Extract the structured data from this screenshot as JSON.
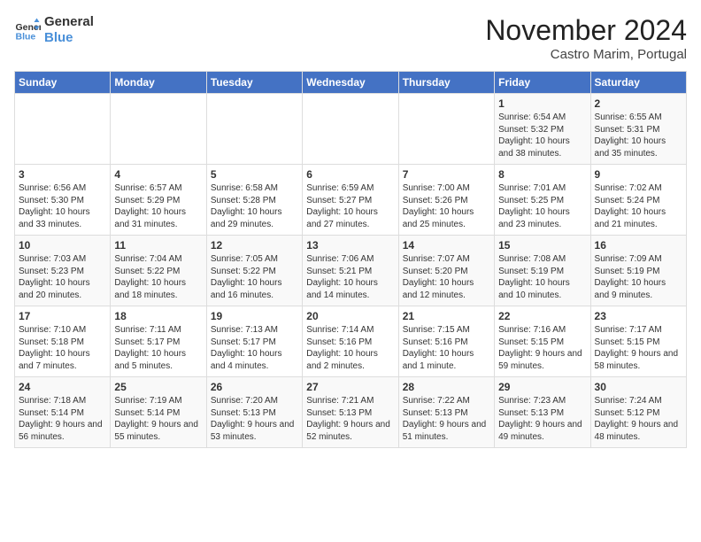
{
  "logo": {
    "line1": "General",
    "line2": "Blue"
  },
  "header": {
    "month": "November 2024",
    "location": "Castro Marim, Portugal"
  },
  "days_of_week": [
    "Sunday",
    "Monday",
    "Tuesday",
    "Wednesday",
    "Thursday",
    "Friday",
    "Saturday"
  ],
  "weeks": [
    [
      {
        "day": "",
        "content": ""
      },
      {
        "day": "",
        "content": ""
      },
      {
        "day": "",
        "content": ""
      },
      {
        "day": "",
        "content": ""
      },
      {
        "day": "",
        "content": ""
      },
      {
        "day": "1",
        "content": "Sunrise: 6:54 AM\nSunset: 5:32 PM\nDaylight: 10 hours and 38 minutes."
      },
      {
        "day": "2",
        "content": "Sunrise: 6:55 AM\nSunset: 5:31 PM\nDaylight: 10 hours and 35 minutes."
      }
    ],
    [
      {
        "day": "3",
        "content": "Sunrise: 6:56 AM\nSunset: 5:30 PM\nDaylight: 10 hours and 33 minutes."
      },
      {
        "day": "4",
        "content": "Sunrise: 6:57 AM\nSunset: 5:29 PM\nDaylight: 10 hours and 31 minutes."
      },
      {
        "day": "5",
        "content": "Sunrise: 6:58 AM\nSunset: 5:28 PM\nDaylight: 10 hours and 29 minutes."
      },
      {
        "day": "6",
        "content": "Sunrise: 6:59 AM\nSunset: 5:27 PM\nDaylight: 10 hours and 27 minutes."
      },
      {
        "day": "7",
        "content": "Sunrise: 7:00 AM\nSunset: 5:26 PM\nDaylight: 10 hours and 25 minutes."
      },
      {
        "day": "8",
        "content": "Sunrise: 7:01 AM\nSunset: 5:25 PM\nDaylight: 10 hours and 23 minutes."
      },
      {
        "day": "9",
        "content": "Sunrise: 7:02 AM\nSunset: 5:24 PM\nDaylight: 10 hours and 21 minutes."
      }
    ],
    [
      {
        "day": "10",
        "content": "Sunrise: 7:03 AM\nSunset: 5:23 PM\nDaylight: 10 hours and 20 minutes."
      },
      {
        "day": "11",
        "content": "Sunrise: 7:04 AM\nSunset: 5:22 PM\nDaylight: 10 hours and 18 minutes."
      },
      {
        "day": "12",
        "content": "Sunrise: 7:05 AM\nSunset: 5:22 PM\nDaylight: 10 hours and 16 minutes."
      },
      {
        "day": "13",
        "content": "Sunrise: 7:06 AM\nSunset: 5:21 PM\nDaylight: 10 hours and 14 minutes."
      },
      {
        "day": "14",
        "content": "Sunrise: 7:07 AM\nSunset: 5:20 PM\nDaylight: 10 hours and 12 minutes."
      },
      {
        "day": "15",
        "content": "Sunrise: 7:08 AM\nSunset: 5:19 PM\nDaylight: 10 hours and 10 minutes."
      },
      {
        "day": "16",
        "content": "Sunrise: 7:09 AM\nSunset: 5:19 PM\nDaylight: 10 hours and 9 minutes."
      }
    ],
    [
      {
        "day": "17",
        "content": "Sunrise: 7:10 AM\nSunset: 5:18 PM\nDaylight: 10 hours and 7 minutes."
      },
      {
        "day": "18",
        "content": "Sunrise: 7:11 AM\nSunset: 5:17 PM\nDaylight: 10 hours and 5 minutes."
      },
      {
        "day": "19",
        "content": "Sunrise: 7:13 AM\nSunset: 5:17 PM\nDaylight: 10 hours and 4 minutes."
      },
      {
        "day": "20",
        "content": "Sunrise: 7:14 AM\nSunset: 5:16 PM\nDaylight: 10 hours and 2 minutes."
      },
      {
        "day": "21",
        "content": "Sunrise: 7:15 AM\nSunset: 5:16 PM\nDaylight: 10 hours and 1 minute."
      },
      {
        "day": "22",
        "content": "Sunrise: 7:16 AM\nSunset: 5:15 PM\nDaylight: 9 hours and 59 minutes."
      },
      {
        "day": "23",
        "content": "Sunrise: 7:17 AM\nSunset: 5:15 PM\nDaylight: 9 hours and 58 minutes."
      }
    ],
    [
      {
        "day": "24",
        "content": "Sunrise: 7:18 AM\nSunset: 5:14 PM\nDaylight: 9 hours and 56 minutes."
      },
      {
        "day": "25",
        "content": "Sunrise: 7:19 AM\nSunset: 5:14 PM\nDaylight: 9 hours and 55 minutes."
      },
      {
        "day": "26",
        "content": "Sunrise: 7:20 AM\nSunset: 5:13 PM\nDaylight: 9 hours and 53 minutes."
      },
      {
        "day": "27",
        "content": "Sunrise: 7:21 AM\nSunset: 5:13 PM\nDaylight: 9 hours and 52 minutes."
      },
      {
        "day": "28",
        "content": "Sunrise: 7:22 AM\nSunset: 5:13 PM\nDaylight: 9 hours and 51 minutes."
      },
      {
        "day": "29",
        "content": "Sunrise: 7:23 AM\nSunset: 5:13 PM\nDaylight: 9 hours and 49 minutes."
      },
      {
        "day": "30",
        "content": "Sunrise: 7:24 AM\nSunset: 5:12 PM\nDaylight: 9 hours and 48 minutes."
      }
    ]
  ]
}
